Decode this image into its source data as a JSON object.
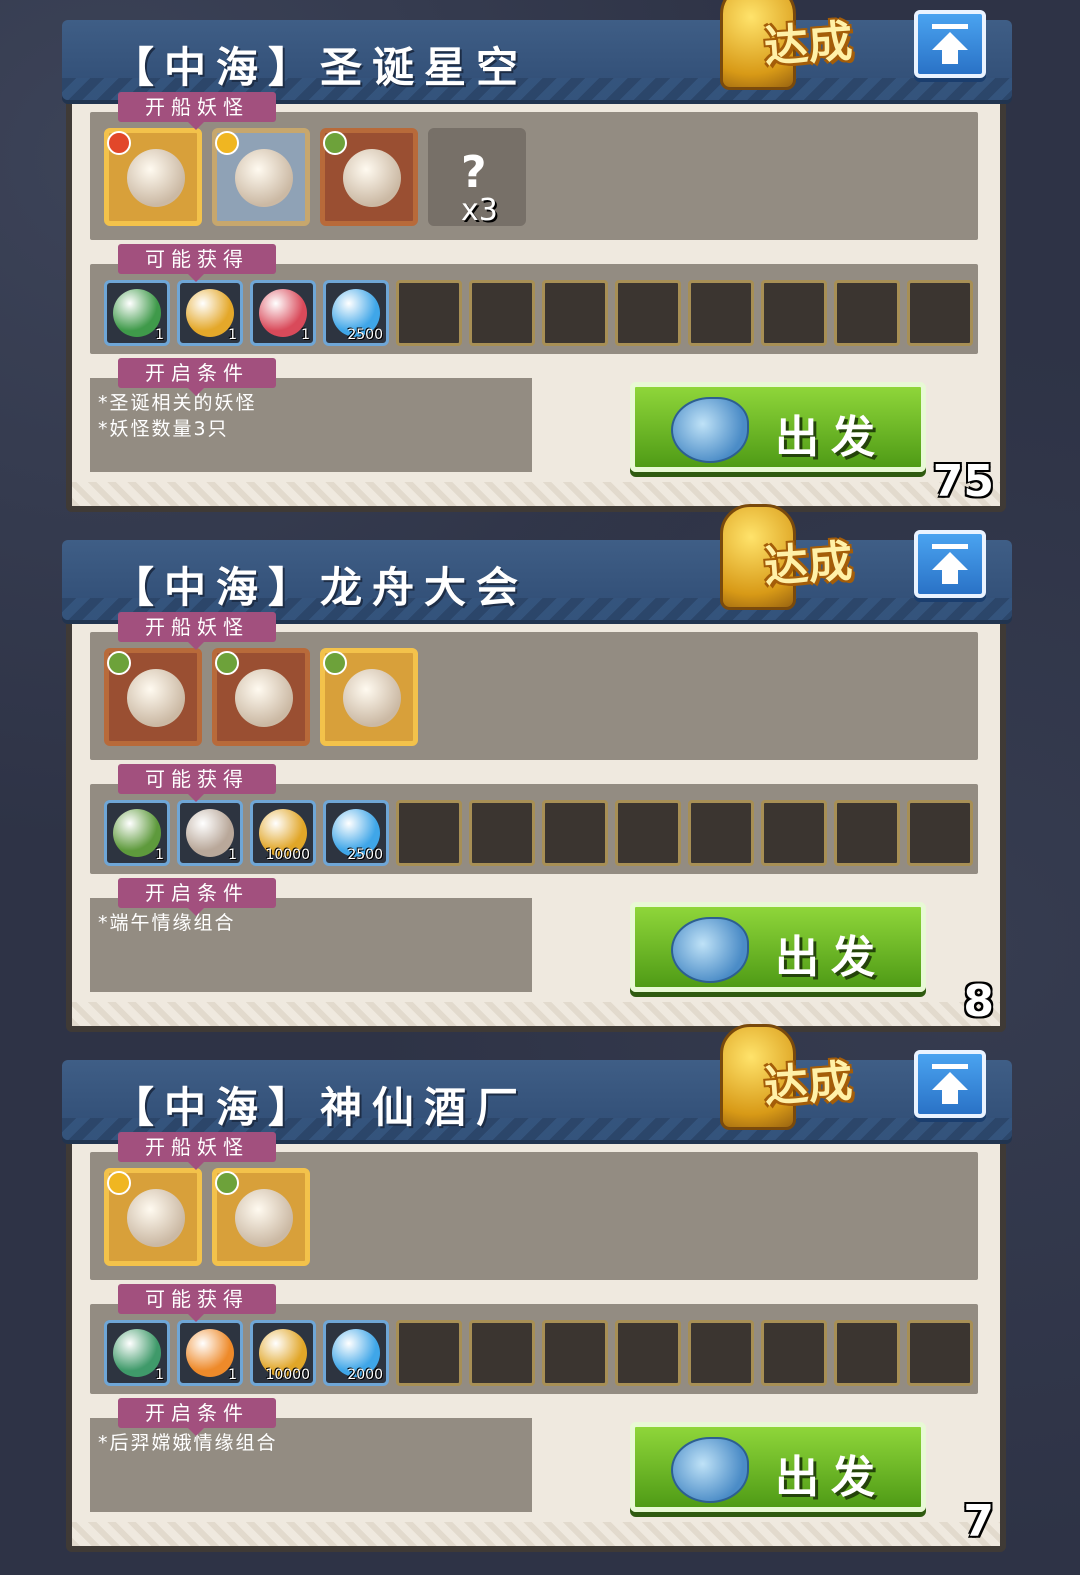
{
  "labels": {
    "monsters": "开船妖怪",
    "rewards": "可能获得",
    "conditions": "开启条件",
    "achieved": "达成",
    "go": "出发"
  },
  "colors": {
    "header": "#2f4c74",
    "section_label": "#a2507e",
    "go_button": "#6cba28",
    "badge_gold": "#f3c24b"
  },
  "cards": [
    {
      "title": "【中海】圣诞星空",
      "monsters": [
        {
          "icon": "gift-box-monster-icon",
          "element": "fire",
          "frame": "gold"
        },
        {
          "icon": "rabbit-monster-icon",
          "element": "sun",
          "frame": "blue"
        },
        {
          "icon": "pinecone-monster-icon",
          "element": "leaf",
          "frame": "brown"
        },
        {
          "icon": "unknown-monster-icon",
          "element": "",
          "frame": "unknown",
          "mark": "?",
          "count": "x3"
        }
      ],
      "rewards": [
        {
          "icon": "christmas-stocking-orb-icon",
          "qty": "1",
          "color": "#3f9a4a"
        },
        {
          "icon": "bell-orb-icon",
          "qty": "1",
          "color": "#e4a82a"
        },
        {
          "icon": "candy-cane-orb-icon",
          "qty": "1",
          "color": "#d94a5a"
        },
        {
          "icon": "blue-crystal-icon",
          "qty": "2500",
          "color": "#3fa6e8"
        }
      ],
      "conditions": [
        "*圣诞相关的妖怪",
        "*妖怪数量3只"
      ],
      "count": "75"
    },
    {
      "title": "【中海】龙舟大会",
      "monsters": [
        {
          "icon": "zongzi-monster-icon",
          "element": "leaf",
          "frame": "brown"
        },
        {
          "icon": "zongzi-monster-icon",
          "element": "leaf",
          "frame": "brown"
        },
        {
          "icon": "dragon-boat-monster-icon",
          "element": "leaf",
          "frame": "gold"
        }
      ],
      "rewards": [
        {
          "icon": "leaf-orb-icon",
          "qty": "1",
          "color": "#5e9a3c"
        },
        {
          "icon": "rice-orb-icon",
          "qty": "1",
          "color": "#b9a89a"
        },
        {
          "icon": "gold-coins-icon",
          "qty": "10000",
          "color": "#e1a628"
        },
        {
          "icon": "blue-crystal-icon",
          "qty": "2500",
          "color": "#3fa6e8"
        }
      ],
      "conditions": [
        "*端午情缘组合"
      ],
      "count": "8"
    },
    {
      "title": "【中海】神仙酒厂",
      "monsters": [
        {
          "icon": "glowing-orb-monster-icon",
          "element": "sun",
          "frame": "gold"
        },
        {
          "icon": "wine-jar-monster-icon",
          "element": "leaf",
          "frame": "gold"
        }
      ],
      "rewards": [
        {
          "icon": "green-gourd-orb-icon",
          "qty": "1",
          "color": "#3f9a6a"
        },
        {
          "icon": "orange-flower-orb-icon",
          "qty": "1",
          "color": "#ee8a2a"
        },
        {
          "icon": "gold-coins-icon",
          "qty": "10000",
          "color": "#e1a628"
        },
        {
          "icon": "blue-crystal-icon",
          "qty": "2000",
          "color": "#3fa6e8"
        }
      ],
      "conditions": [
        "*后羿嫦娥情缘组合"
      ],
      "count": "7"
    }
  ]
}
